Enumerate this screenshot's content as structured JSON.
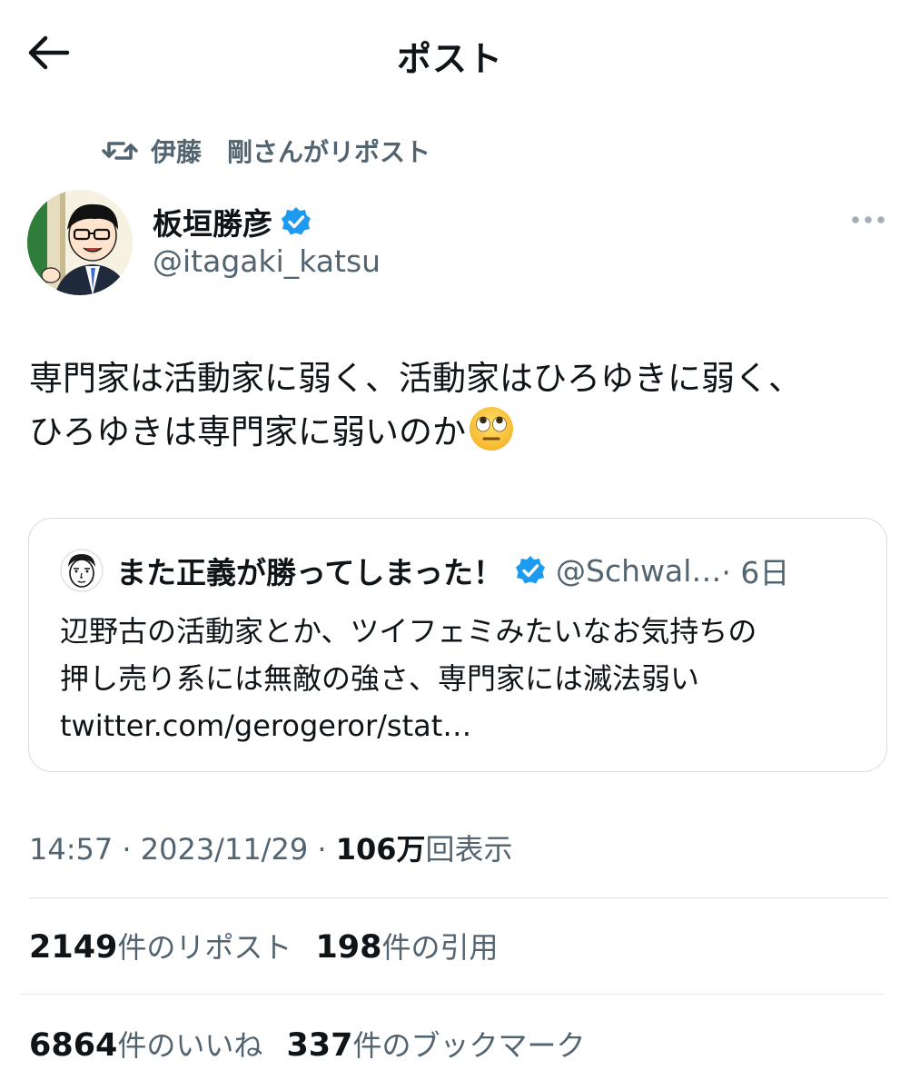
{
  "header": {
    "title": "ポスト"
  },
  "repost": {
    "text": "伊藤　剛さんがリポスト"
  },
  "author": {
    "name": "板垣勝彦",
    "handle": "@itagaki_katsu"
  },
  "tweet": {
    "lines": [
      "専門家は活動家に弱く、活動家はひろゆきに弱く、",
      "ひろゆきは専門家に弱いのか"
    ],
    "emoji": "face-with-rolling-eyes"
  },
  "quote": {
    "name": "また正義が勝ってしまった！",
    "handle": "@Schwal…",
    "time": "· 6日",
    "lines": [
      "辺野古の活動家とか、ツイフェミみたいなお気持ちの",
      "押し売り系には無敵の強さ、専門家には滅法弱い",
      "twitter.com/gerogeror/stat…"
    ]
  },
  "meta": {
    "time": "14:57",
    "sep1": " · ",
    "date": "2023/11/29",
    "sep2": " · ",
    "views_num": "106万",
    "views_label": "回表示"
  },
  "stats": {
    "reposts_num": "2149",
    "reposts_label": "件のリポスト",
    "quotes_num": "198",
    "quotes_label": "件の引用",
    "likes_num": "6864",
    "likes_label": "件のいいね",
    "bookmarks_num": "337",
    "bookmarks_label": "件のブックマーク"
  },
  "colors": {
    "accent_verified": "#1d9bf0",
    "secondary_text": "#536471",
    "primary_text": "#0f1419"
  }
}
